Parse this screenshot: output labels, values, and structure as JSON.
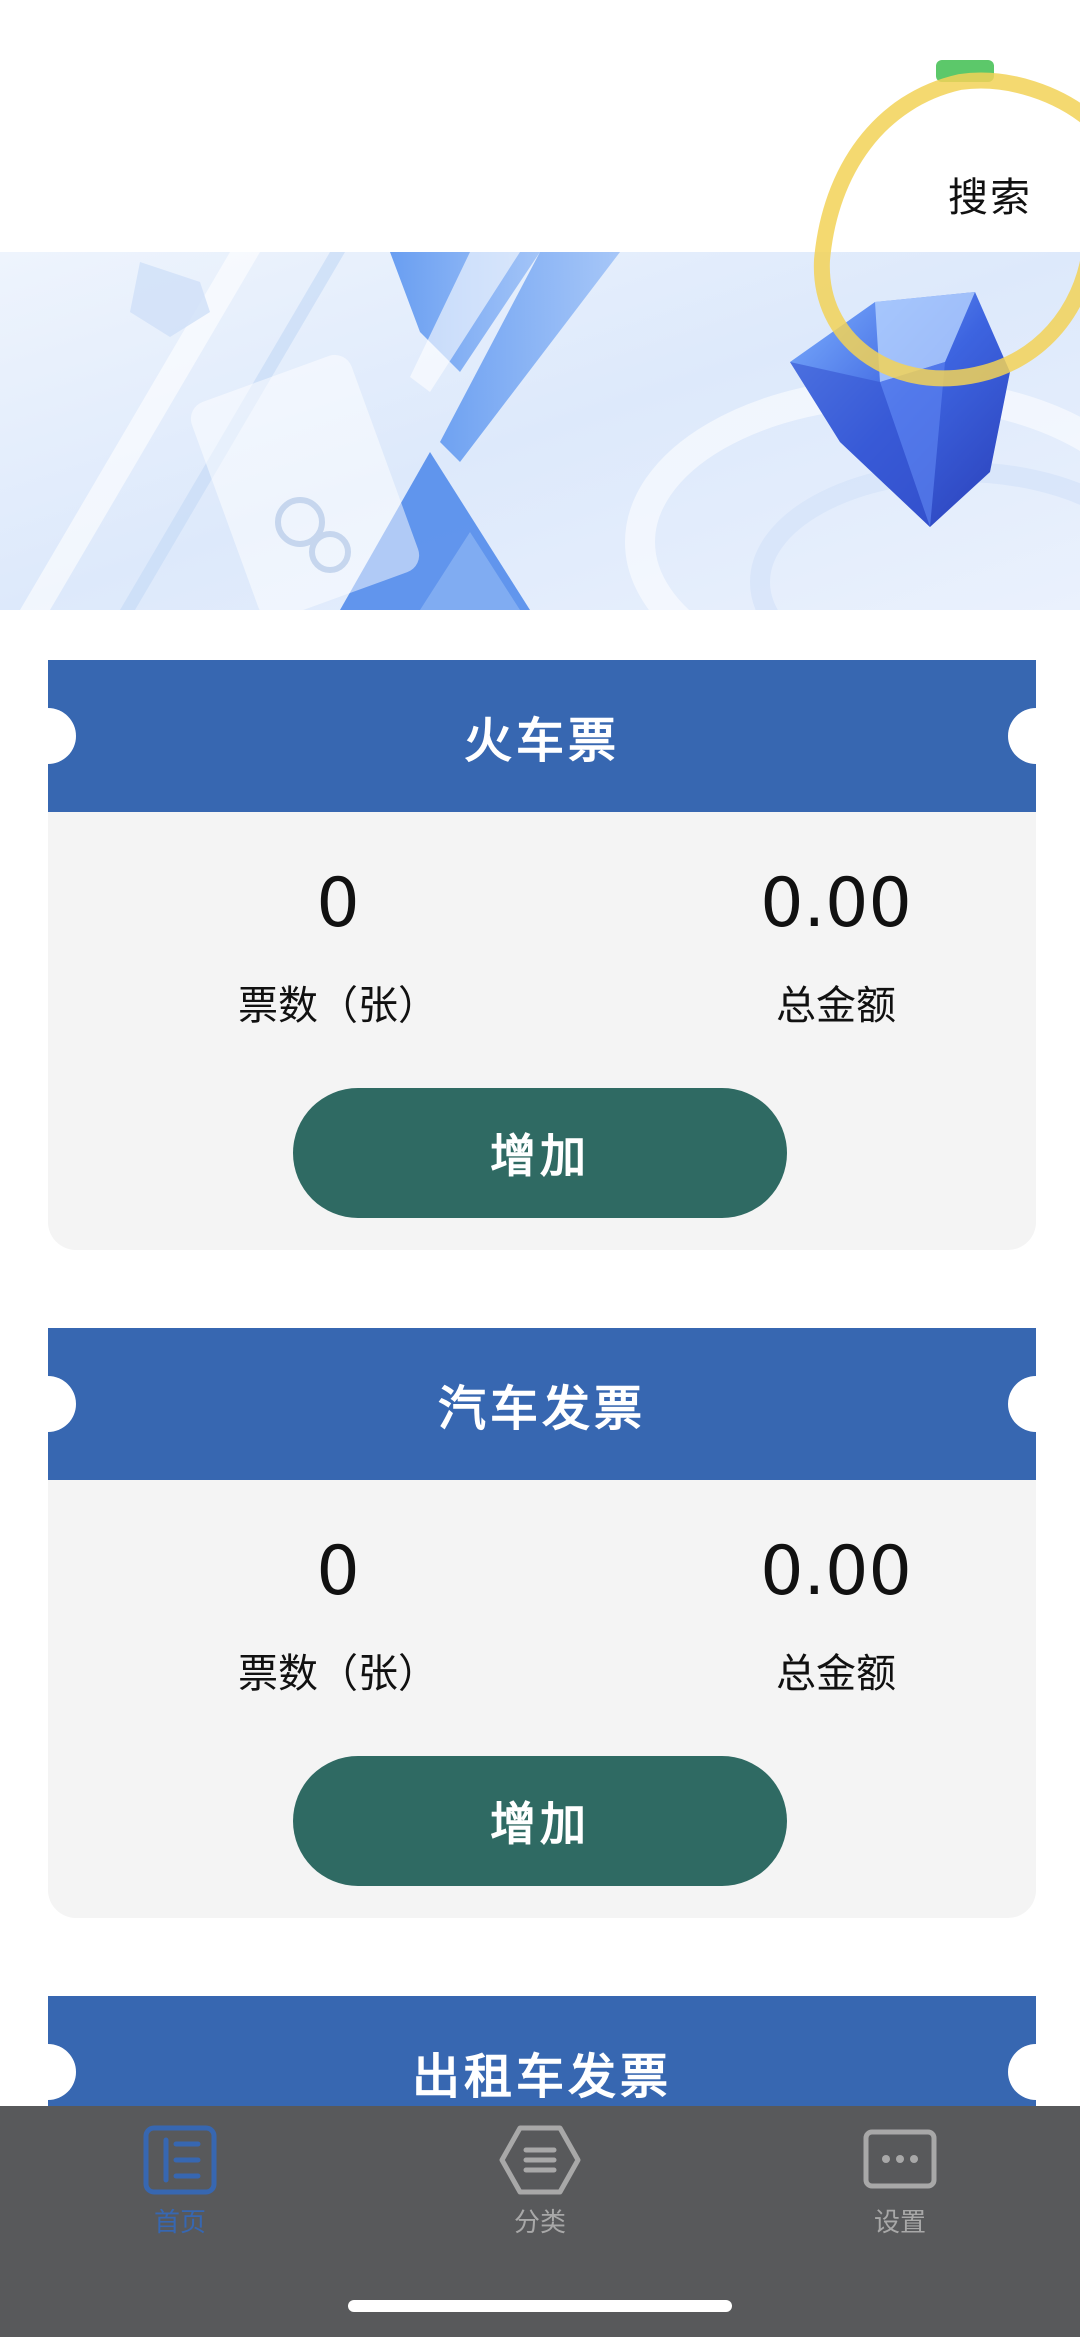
{
  "header": {
    "search_label": "搜索"
  },
  "cards": [
    {
      "title": "火车票",
      "count_value": "0",
      "count_label": "票数（张）",
      "amount_value": "0.00",
      "amount_label": "总金额",
      "add_label": "增加"
    },
    {
      "title": "汽车发票",
      "count_value": "0",
      "count_label": "票数（张）",
      "amount_value": "0.00",
      "amount_label": "总金额",
      "add_label": "增加"
    },
    {
      "title": "出租车发票"
    }
  ],
  "tabbar": {
    "items": [
      {
        "label": "首页",
        "icon": "home-icon",
        "active": true
      },
      {
        "label": "分类",
        "icon": "category-icon",
        "active": false
      },
      {
        "label": "设置",
        "icon": "settings-icon",
        "active": false
      }
    ]
  },
  "colors": {
    "card_header": "#3767b1",
    "card_body": "#f4f4f4",
    "add_button": "#2f6a63",
    "tabbar": "#58595b",
    "active_tab": "#3767b1",
    "highlight": "#f2d257"
  }
}
